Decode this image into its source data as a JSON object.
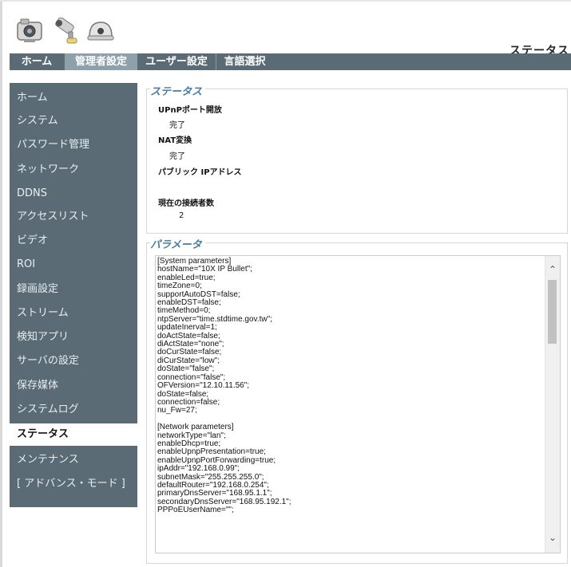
{
  "header": {
    "title": "ステータス",
    "icons": [
      "camera-icon",
      "bullet-camera-icon",
      "dome-camera-icon"
    ]
  },
  "tabs": [
    {
      "id": "home",
      "label": "ホーム"
    },
    {
      "id": "admin",
      "label": "管理者設定"
    },
    {
      "id": "user",
      "label": "ユーザー設定"
    },
    {
      "id": "lang",
      "label": "言語選択"
    }
  ],
  "sidebar": {
    "items": [
      {
        "label": "ホーム"
      },
      {
        "label": "システム"
      },
      {
        "label": "パスワード管理"
      },
      {
        "label": "ネットワーク"
      },
      {
        "label": "DDNS"
      },
      {
        "label": "アクセスリスト"
      },
      {
        "label": "ビデオ"
      },
      {
        "label": "ROI"
      },
      {
        "label": "録画設定"
      },
      {
        "label": "ストリーム"
      },
      {
        "label": "検知アプリ"
      },
      {
        "label": "サーバの設定"
      },
      {
        "label": "保存媒体"
      },
      {
        "label": "システムログ"
      },
      {
        "label": "ステータス"
      },
      {
        "label": "メンテナンス"
      },
      {
        "label": "[ アドバンス・モード ]"
      }
    ],
    "active": "ステータス"
  },
  "status": {
    "section_title": "ステータス",
    "upnp_label": "UPnPポート開放",
    "upnp_value": "完了",
    "nat_label": "NAT変換",
    "nat_value": "完了",
    "public_ip_label": "パブリック IPアドレス",
    "public_ip_value": "",
    "connections_label": "現在の接続者数",
    "connections_value": "2"
  },
  "parameters": {
    "section_title": "パラメータ",
    "lines": [
      "[System parameters]",
      "hostName=\"10X IP Bullet\";",
      "enableLed=true;",
      "timeZone=0;",
      "supportAutoDST=false;",
      "enableDST=false;",
      "timeMethod=0;",
      "ntpServer=\"time.stdtime.gov.tw\";",
      "updateInerval=1;",
      "doActState=false;",
      "diActState=\"none\";",
      "doCurState=false;",
      "diCurState=\"low\";",
      "doState=\"false\";",
      "connection=\"false\";",
      "OFVersion=\"12.10.11.56\";",
      "doState=false;",
      "connection=false;",
      "nu_Fw=27;",
      "",
      "[Network parameters]",
      "networkType=\"lan\";",
      "enableDhcp=true;",
      "enableUpnpPresentation=true;",
      "enableUpnpPortForwarding=true;",
      "ipAddr=\"192.168.0.99\";",
      "subnetMask=\"255.255.255.0\";",
      "defaultRouter=\"192.168.0.254\";",
      "primaryDnsServer=\"168.95.1.1\";",
      "secondaryDnsServer=\"168.95.192.1\";",
      "PPPoEUserName=\"\";"
    ]
  }
}
